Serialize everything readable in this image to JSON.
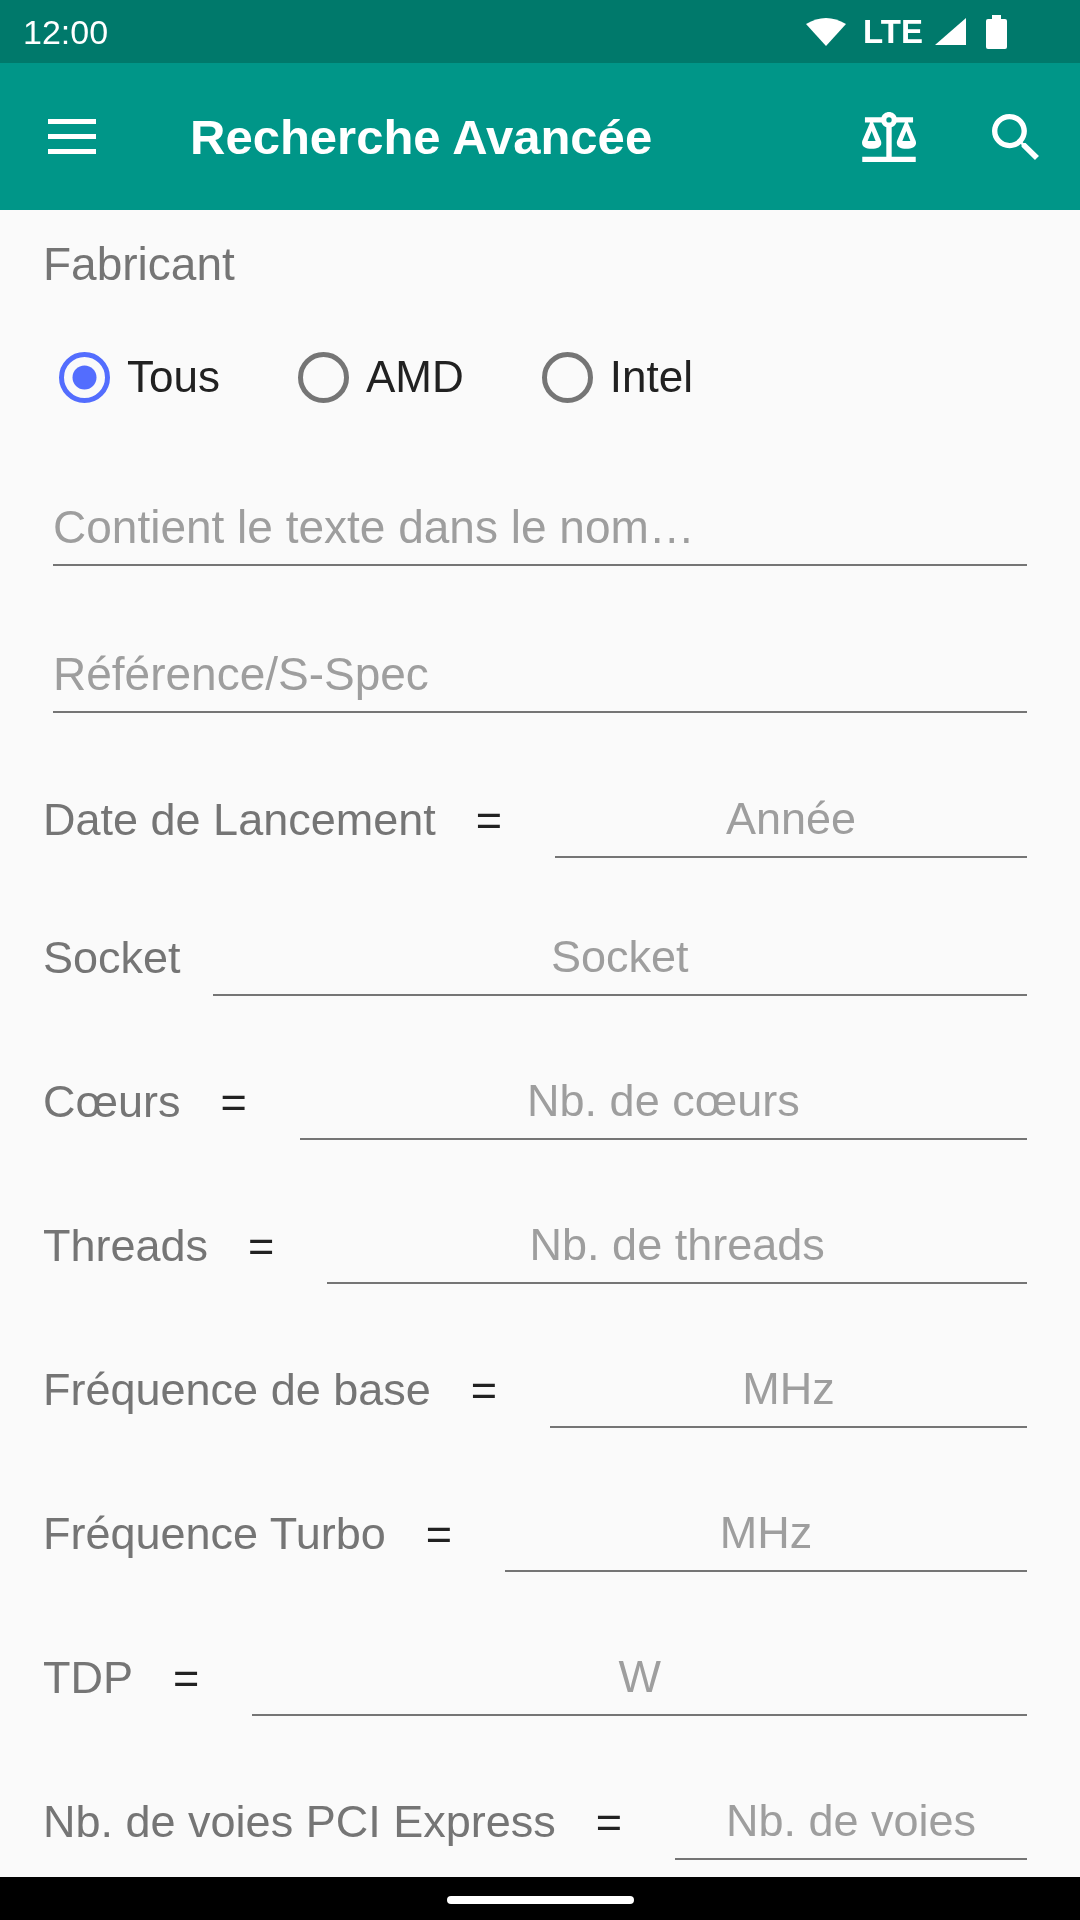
{
  "status_bar": {
    "time": "12:00",
    "network": "LTE"
  },
  "toolbar": {
    "title": "Recherche Avancée"
  },
  "manufacturer": {
    "label": "Fabricant",
    "options": [
      {
        "label": "Tous",
        "selected": true
      },
      {
        "label": "AMD",
        "selected": false
      },
      {
        "label": "Intel",
        "selected": false
      }
    ]
  },
  "text_fields": [
    {
      "placeholder": "Contient le texte dans le nom…"
    },
    {
      "placeholder": "Référence/S-Spec"
    }
  ],
  "filters": [
    {
      "label": "Date de Lancement",
      "operator": "=",
      "placeholder": "Année"
    },
    {
      "label": "Socket",
      "placeholder": "Socket"
    },
    {
      "label": "Cœurs",
      "operator": "=",
      "placeholder": "Nb. de cœurs"
    },
    {
      "label": "Threads",
      "operator": "=",
      "placeholder": "Nb. de threads"
    },
    {
      "label": "Fréquence de base",
      "operator": "=",
      "placeholder": "MHz"
    },
    {
      "label": "Fréquence Turbo",
      "operator": "=",
      "placeholder": "MHz"
    },
    {
      "label": "TDP",
      "operator": "=",
      "placeholder": "W"
    },
    {
      "label": "Nb. de voies PCI Express",
      "operator": "=",
      "placeholder": "Nb. de voies"
    }
  ]
}
